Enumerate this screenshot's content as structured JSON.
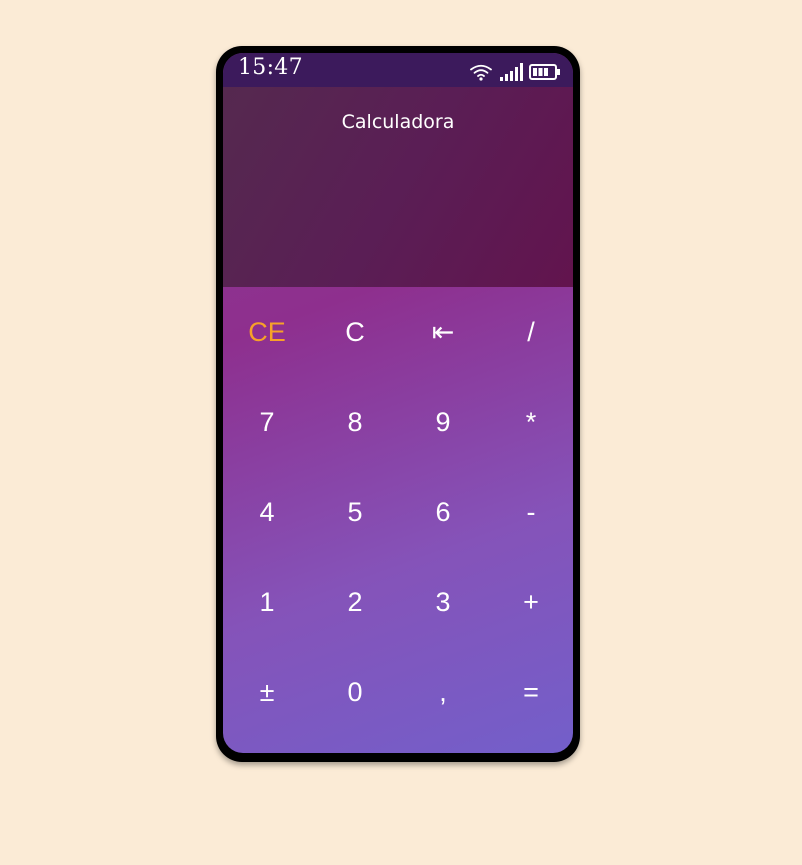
{
  "status_bar": {
    "time": "15:47",
    "icons": [
      "wifi-icon",
      "signal-icon",
      "battery-icon"
    ]
  },
  "app": {
    "title": "Calculadora",
    "expression": "",
    "result": ""
  },
  "keypad": {
    "rows": [
      [
        {
          "id": "ce",
          "label": "CE",
          "name": "clear-entry-button",
          "accent": true
        },
        {
          "id": "c",
          "label": "C",
          "name": "clear-button"
        },
        {
          "id": "back",
          "label": "⇤",
          "name": "backspace-button"
        },
        {
          "id": "div",
          "label": "/",
          "name": "divide-button"
        }
      ],
      [
        {
          "id": "7",
          "label": "7",
          "name": "digit-7-button"
        },
        {
          "id": "8",
          "label": "8",
          "name": "digit-8-button"
        },
        {
          "id": "9",
          "label": "9",
          "name": "digit-9-button"
        },
        {
          "id": "mul",
          "label": "*",
          "name": "multiply-button"
        }
      ],
      [
        {
          "id": "4",
          "label": "4",
          "name": "digit-4-button"
        },
        {
          "id": "5",
          "label": "5",
          "name": "digit-5-button"
        },
        {
          "id": "6",
          "label": "6",
          "name": "digit-6-button"
        },
        {
          "id": "sub",
          "label": "-",
          "name": "subtract-button"
        }
      ],
      [
        {
          "id": "1",
          "label": "1",
          "name": "digit-1-button"
        },
        {
          "id": "2",
          "label": "2",
          "name": "digit-2-button"
        },
        {
          "id": "3",
          "label": "3",
          "name": "digit-3-button"
        },
        {
          "id": "add",
          "label": "+",
          "name": "add-button"
        }
      ],
      [
        {
          "id": "sign",
          "label": "±",
          "name": "toggle-sign-button"
        },
        {
          "id": "0",
          "label": "0",
          "name": "digit-0-button"
        },
        {
          "id": "comma",
          "label": ",",
          "name": "decimal-comma-button"
        },
        {
          "id": "eq",
          "label": "=",
          "name": "equals-button"
        }
      ]
    ]
  },
  "colors": {
    "page_background": "#fbebd6",
    "status_bar": "#3c1a5c",
    "display_background": "#5a1e55",
    "accent": "#f7a128",
    "key_text": "#ffffff"
  }
}
